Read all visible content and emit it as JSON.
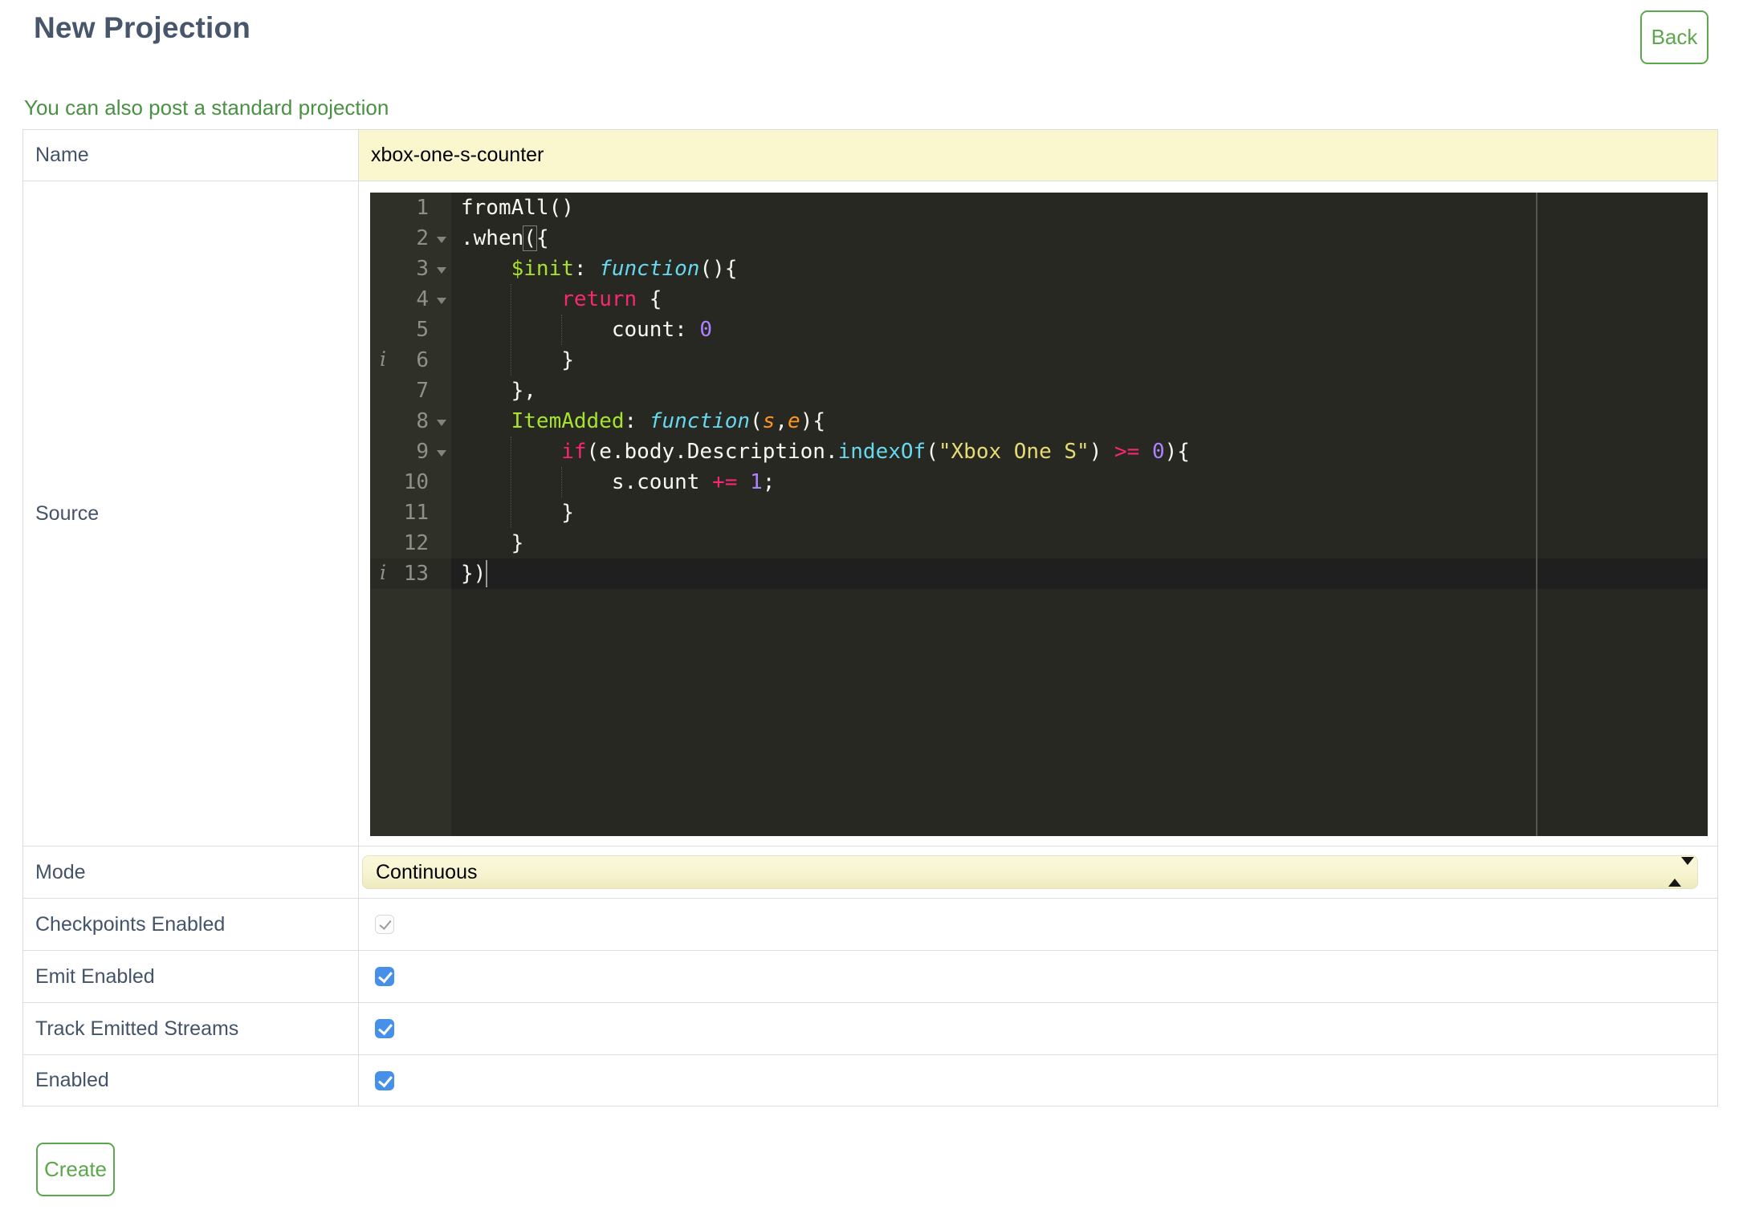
{
  "page": {
    "title": "New Projection"
  },
  "header": {
    "back_button": "Back"
  },
  "subheader": {
    "link_text": "You can also post a standard projection"
  },
  "form": {
    "labels": {
      "name": "Name",
      "source": "Source",
      "mode": "Mode",
      "checkpoints": "Checkpoints Enabled",
      "emit": "Emit Enabled",
      "track": "Track Emitted Streams",
      "enabled": "Enabled"
    },
    "name_value": "xbox-one-s-counter",
    "mode_value": "Continuous",
    "checkboxes": {
      "checkpoints": {
        "checked": true,
        "disabled": true
      },
      "emit": {
        "checked": true,
        "disabled": false
      },
      "track": {
        "checked": true,
        "disabled": false
      },
      "enabled": {
        "checked": true,
        "disabled": false
      }
    }
  },
  "actions": {
    "create_button": "Create"
  },
  "editor": {
    "language": "javascript",
    "theme": "monokai",
    "active_line": 13,
    "cursor": {
      "line": 13,
      "col": 2
    },
    "annotations": [
      {
        "line": 6,
        "type": "info"
      },
      {
        "line": 13,
        "type": "info"
      }
    ],
    "fold_lines": [
      2,
      3,
      4,
      8,
      9
    ],
    "lines": [
      {
        "num": 1,
        "tokens": [
          [
            "pl",
            "fromAll()"
          ]
        ]
      },
      {
        "num": 2,
        "fold": true,
        "tokens": [
          [
            "pl",
            ".when"
          ],
          [
            "brk",
            "("
          ],
          [
            "pl",
            "{"
          ]
        ]
      },
      {
        "num": 3,
        "fold": true,
        "tokens": [
          [
            "pl",
            "    "
          ],
          [
            "ent",
            "$init"
          ],
          [
            "pl",
            ": "
          ],
          [
            "fn",
            "function"
          ],
          [
            "pl",
            "(){"
          ]
        ]
      },
      {
        "num": 4,
        "fold": true,
        "tokens": [
          [
            "pl",
            "        "
          ],
          [
            "kw",
            "return"
          ],
          [
            "pl",
            " {"
          ]
        ]
      },
      {
        "num": 5,
        "tokens": [
          [
            "pl",
            "            count: "
          ],
          [
            "num",
            "0"
          ]
        ]
      },
      {
        "num": 6,
        "info": true,
        "tokens": [
          [
            "pl",
            "        }"
          ]
        ]
      },
      {
        "num": 7,
        "tokens": [
          [
            "pl",
            "    },"
          ]
        ]
      },
      {
        "num": 8,
        "fold": true,
        "tokens": [
          [
            "pl",
            "    "
          ],
          [
            "ent",
            "ItemAdded"
          ],
          [
            "pl",
            ": "
          ],
          [
            "fn",
            "function"
          ],
          [
            "pl",
            "("
          ],
          [
            "par",
            "s"
          ],
          [
            "pl",
            ","
          ],
          [
            "par",
            "e"
          ],
          [
            "pl",
            "){"
          ]
        ]
      },
      {
        "num": 9,
        "fold": true,
        "tokens": [
          [
            "pl",
            "        "
          ],
          [
            "kw",
            "if"
          ],
          [
            "pl",
            "(e.body.Description."
          ],
          [
            "sup",
            "indexOf"
          ],
          [
            "pl",
            "("
          ],
          [
            "str",
            "\"Xbox One S\""
          ],
          [
            "pl",
            ") "
          ],
          [
            "kw",
            ">="
          ],
          [
            "pl",
            " "
          ],
          [
            "num",
            "0"
          ],
          [
            "pl",
            "){"
          ]
        ]
      },
      {
        "num": 10,
        "tokens": [
          [
            "pl",
            "            s.count "
          ],
          [
            "kw",
            "+="
          ],
          [
            "pl",
            " "
          ],
          [
            "num",
            "1"
          ],
          [
            "pl",
            ";"
          ]
        ]
      },
      {
        "num": 11,
        "tokens": [
          [
            "pl",
            "        }"
          ]
        ]
      },
      {
        "num": 12,
        "tokens": [
          [
            "pl",
            "    }"
          ]
        ]
      },
      {
        "num": 13,
        "info": true,
        "tokens": [
          [
            "pl",
            "})"
          ]
        ]
      }
    ]
  },
  "colors": {
    "accent_green": "#5CA74C",
    "link_green": "#4A9143",
    "title_slate": "#47566A",
    "autofill_yellow": "#FAF7CF",
    "select_yellow": "#F6F3CF",
    "checkbox_blue": "#4790EA",
    "editor_bg": "#272822",
    "editor_gutter_bg": "#2F3129",
    "editor_active_line": "#1F1F1F",
    "table_border": "#DDDDDD"
  }
}
